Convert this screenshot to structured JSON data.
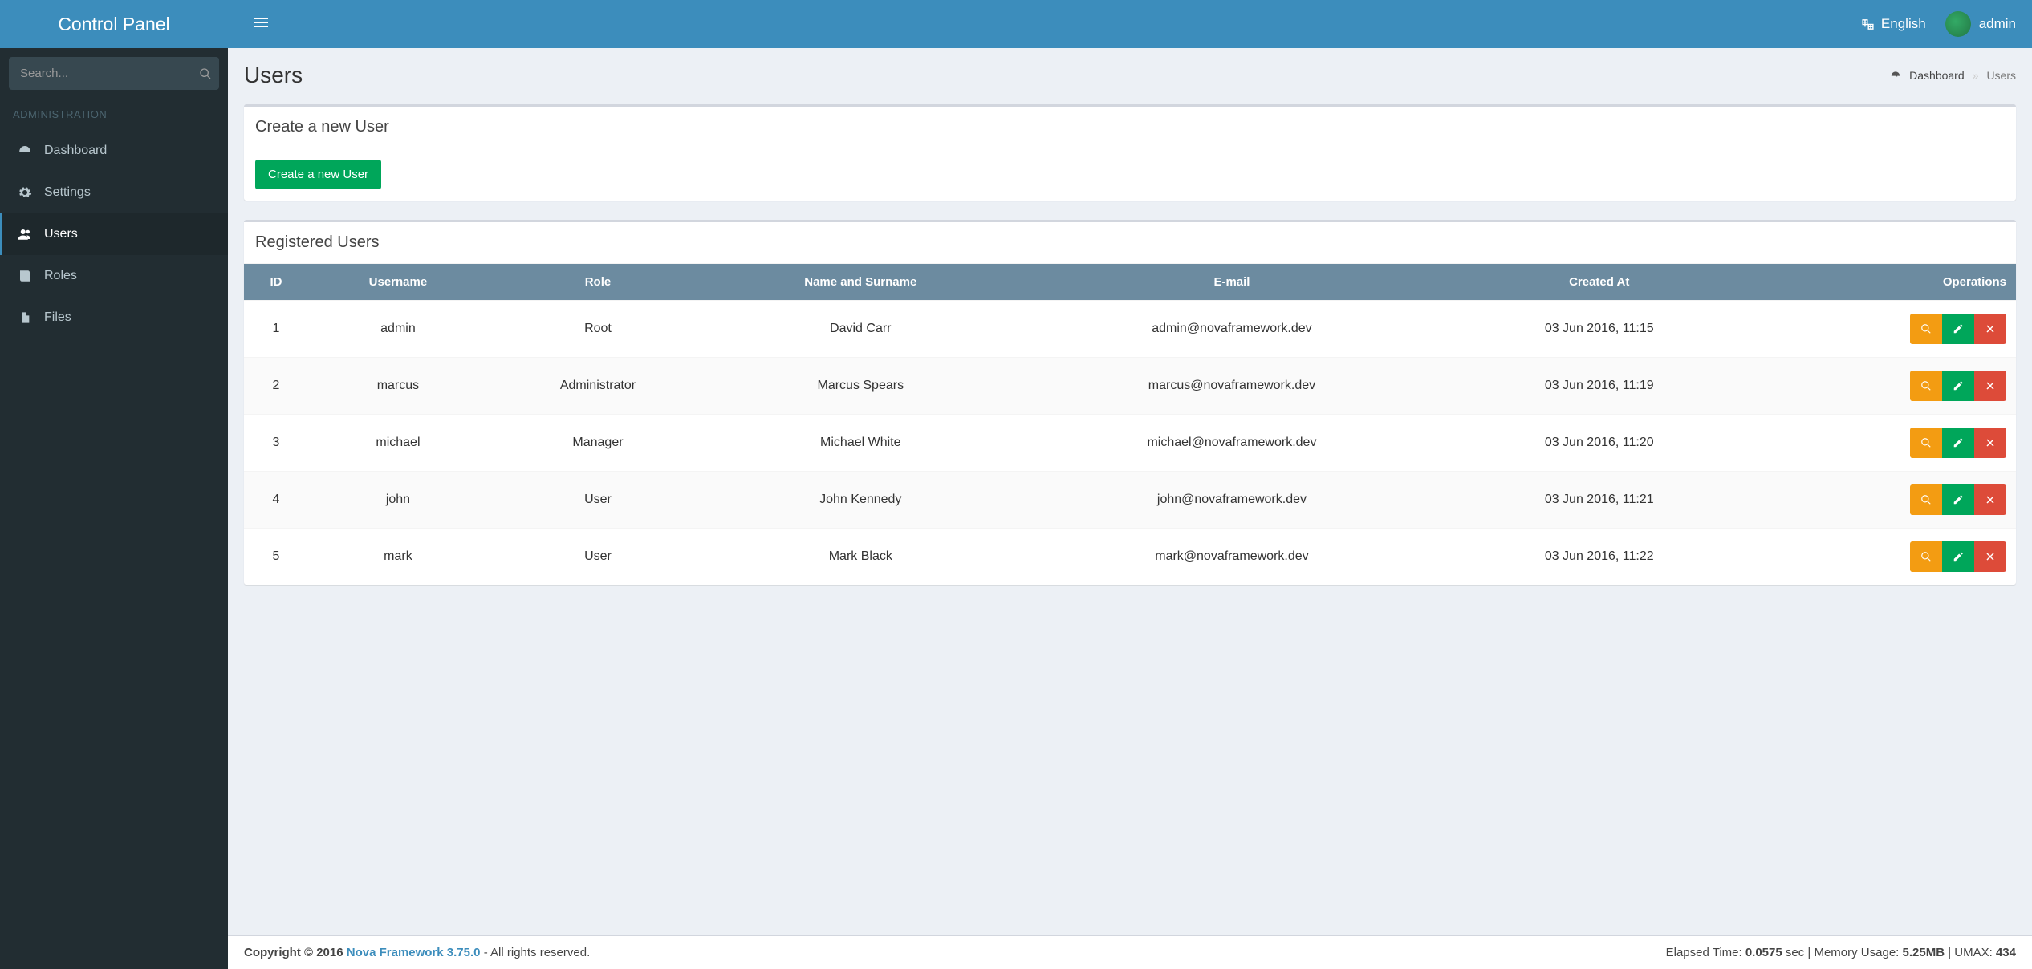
{
  "brand": "Control Panel",
  "search": {
    "placeholder": "Search..."
  },
  "sidebar": {
    "section": "ADMINISTRATION",
    "items": [
      {
        "label": "Dashboard",
        "icon": "dashboard-icon",
        "active": false
      },
      {
        "label": "Settings",
        "icon": "cog-icon",
        "active": false
      },
      {
        "label": "Users",
        "icon": "users-icon",
        "active": true
      },
      {
        "label": "Roles",
        "icon": "book-icon",
        "active": false
      },
      {
        "label": "Files",
        "icon": "file-icon",
        "active": false
      }
    ]
  },
  "header": {
    "language": "English",
    "username": "admin"
  },
  "page": {
    "title": "Users",
    "breadcrumb": {
      "home": "Dashboard",
      "current": "Users"
    }
  },
  "create_box": {
    "title": "Create a new User",
    "button": "Create a new User"
  },
  "list_box": {
    "title": "Registered Users",
    "columns": [
      "ID",
      "Username",
      "Role",
      "Name and Surname",
      "E-mail",
      "Created At",
      "Operations"
    ],
    "rows": [
      {
        "id": "1",
        "username": "admin",
        "role": "Root",
        "name": "David Carr",
        "email": "admin@novaframework.dev",
        "created": "03 Jun 2016, 11:15"
      },
      {
        "id": "2",
        "username": "marcus",
        "role": "Administrator",
        "name": "Marcus Spears",
        "email": "marcus@novaframework.dev",
        "created": "03 Jun 2016, 11:19"
      },
      {
        "id": "3",
        "username": "michael",
        "role": "Manager",
        "name": "Michael White",
        "email": "michael@novaframework.dev",
        "created": "03 Jun 2016, 11:20"
      },
      {
        "id": "4",
        "username": "john",
        "role": "User",
        "name": "John Kennedy",
        "email": "john@novaframework.dev",
        "created": "03 Jun 2016, 11:21"
      },
      {
        "id": "5",
        "username": "mark",
        "role": "User",
        "name": "Mark Black",
        "email": "mark@novaframework.dev",
        "created": "03 Jun 2016, 11:22"
      }
    ]
  },
  "footer": {
    "copyright_prefix": "Copyright © 2016 ",
    "link": "Nova Framework 3.75.0",
    "copyright_suffix": " - All rights reserved.",
    "stats": {
      "elapsed_label": "Elapsed Time: ",
      "elapsed_value": "0.0575",
      "elapsed_unit": " sec | ",
      "mem_label": "Memory Usage: ",
      "mem_value": "5.25MB",
      "sep": " | ",
      "umax_label": "UMAX: ",
      "umax_value": "434"
    }
  }
}
